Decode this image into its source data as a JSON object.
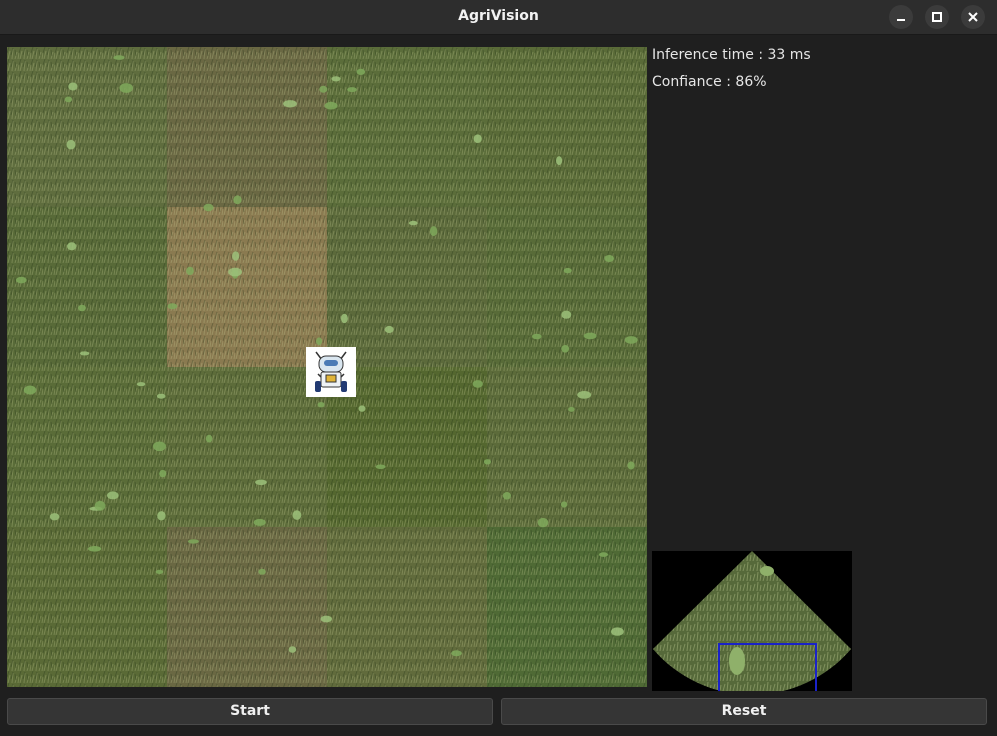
{
  "window": {
    "title": "AgriVision",
    "controls": [
      "minimize-icon",
      "maximize-icon",
      "close-icon"
    ]
  },
  "info": {
    "inference_time": "Inference time : 33 ms",
    "confidence": "Confiance : 86%"
  },
  "field": {
    "grid_rows": 4,
    "grid_cols": 4,
    "tile_colors": [
      [
        "#5f6d3e",
        "#6a6843",
        "#5b6d3a",
        "#5a6b38"
      ],
      [
        "#586a38",
        "#8a7a50",
        "#5c6a3b",
        "#586b38"
      ],
      [
        "#5a6c38",
        "#5d6c3a",
        "#54672f",
        "#5c6b3a"
      ],
      [
        "#5a6a36",
        "#6a6843",
        "#616b3c",
        "#4f6a35"
      ]
    ],
    "robot": "robot-icon"
  },
  "camera_view": {
    "icon": "camera-fov-icon",
    "box_color": "#1a22c8"
  },
  "buttons": {
    "start": "Start",
    "reset": "Reset"
  },
  "colors": {
    "background": "#1f1f1f",
    "titlebar": "#2d2d2d",
    "button": "#353535"
  }
}
